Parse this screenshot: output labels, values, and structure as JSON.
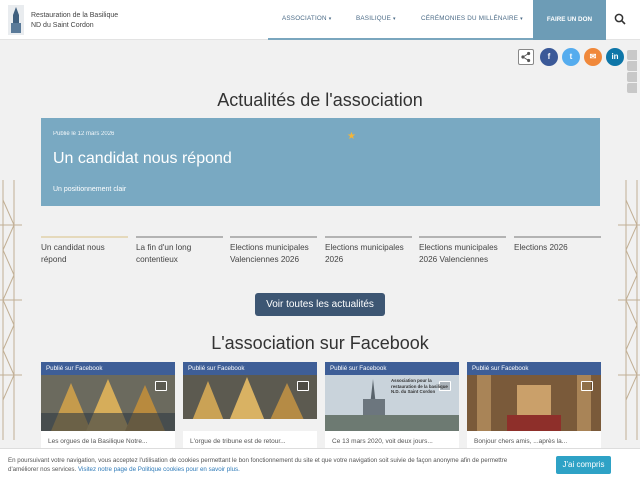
{
  "header": {
    "brand_line1": "Restauration de la Basilique",
    "brand_line2": "ND du Saint Cordon",
    "nav": [
      {
        "label": "Association"
      },
      {
        "label": "Basilique"
      },
      {
        "label": "Cérémonies du millénaire"
      }
    ],
    "donate_label": "Faire un don",
    "search_icon": "search-icon"
  },
  "share": {
    "icons": [
      "share-icon",
      "facebook-icon",
      "twitter-icon",
      "email-icon",
      "linkedin-icon"
    ],
    "colors": {
      "facebook": "#3b5998",
      "twitter": "#55acee",
      "email": "#f0883a",
      "linkedin": "#0e76a8"
    },
    "facebook_glyph": "f",
    "twitter_glyph": "t",
    "email_glyph": "✉",
    "linkedin_glyph": "in"
  },
  "news": {
    "heading": "Actualités de l'association",
    "featured": {
      "date": "Publié le 12 mars 2026",
      "title": "Un candidat nous répond",
      "subtitle": "Un positionnement clair"
    },
    "tabs": [
      {
        "label": "Un candidat nous répond"
      },
      {
        "label": "La fin d'un long contentieux"
      },
      {
        "label": "Elections municipales Valenciennes 2026"
      },
      {
        "label": "Elections municipales 2026"
      },
      {
        "label": "Elections municipales 2026 Valenciennes"
      },
      {
        "label": "Elections 2026"
      }
    ],
    "all_button": "Voir toutes les actualités"
  },
  "facebook": {
    "heading": "L'association sur Facebook",
    "cards": [
      {
        "label": "Publié sur Facebook",
        "text": "Les orgues de la Basilique Notre..."
      },
      {
        "label": "Publié sur Facebook",
        "text": "L'orgue de tribune est de retour..."
      },
      {
        "label": "Publié sur Facebook",
        "text": "Ce 13 mars 2020, voit deux jours..."
      },
      {
        "label": "Publié sur Facebook",
        "text": "Bonjour chers amis, ...après la..."
      }
    ],
    "card3_image_text": "Association pour la restauration de la basilique N.D. du Saint Cordon"
  },
  "cookie": {
    "message": "En poursuivant votre navigation, vous acceptez l'utilisation de cookies permettant le bon fonctionnement du site et que votre navigation soit suivie de façon anonyme afin de permettre d'améliorer nos services.",
    "link": "Visitez notre page de Politique cookies pour en savoir plus.",
    "accept": "J'ai compris"
  }
}
